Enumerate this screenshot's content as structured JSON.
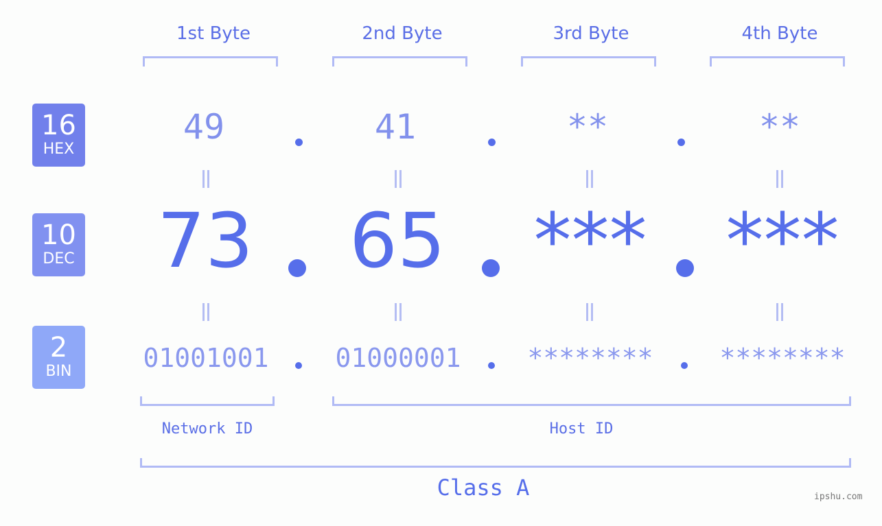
{
  "bases": [
    {
      "num": "16",
      "label": "HEX",
      "color": "#7180eb"
    },
    {
      "num": "10",
      "label": "DEC",
      "color": "#8191f0"
    },
    {
      "num": "2",
      "label": "BIN",
      "color": "#8fa8f8"
    }
  ],
  "byte_labels": [
    "1st Byte",
    "2nd Byte",
    "3rd Byte",
    "4th Byte"
  ],
  "hex": [
    "49",
    "41",
    "**",
    "**"
  ],
  "dec": [
    "73",
    "65",
    "***",
    "***"
  ],
  "bin": [
    "01001001",
    "01000001",
    "********",
    "********"
  ],
  "separator": ".",
  "network_id_label": "Network ID",
  "host_id_label": "Host ID",
  "class_label": "Class A",
  "watermark": "ipshu.com"
}
